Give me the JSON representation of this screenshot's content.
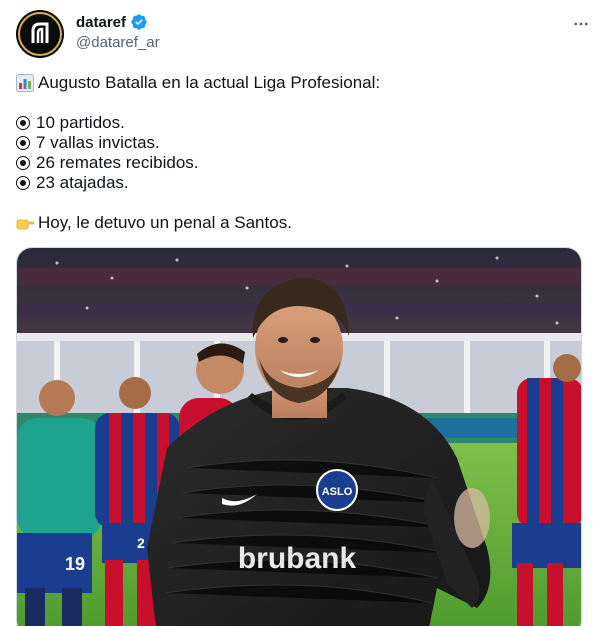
{
  "account": {
    "display_name": "dataref",
    "handle": "@dataref_ar",
    "verified": true,
    "avatar_icon": "dataref-logo-icon"
  },
  "tweet": {
    "title_line": "Augusto Batalla en la actual Liga Profesional:",
    "title_icon": "bar-chart-emoji",
    "stats": [
      "10 partidos.",
      "7 vallas invictas.",
      "26 remates recibidos.",
      "23 atajadas."
    ],
    "closing_line": "Hoy, le detuvo un penal a Santos.",
    "closing_icon": "pointing-hand-emoji"
  },
  "media": {
    "jersey_brand": "brubank",
    "back_number": "19",
    "side_number": "2"
  },
  "colors": {
    "text": "#0f1419",
    "muted": "#536471",
    "verified": "#1d9bf0",
    "border": "#cfd9de"
  }
}
